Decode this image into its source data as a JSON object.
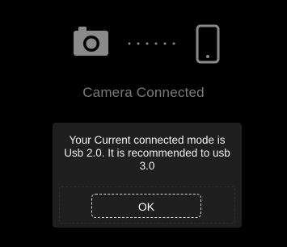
{
  "connection": {
    "left_icon": "camera-icon",
    "right_icon": "phone-icon",
    "link_icon": "dotted-link-icon",
    "icon_color": "#8a8a8a"
  },
  "status": {
    "label": "Camera Connected"
  },
  "dialog": {
    "message": "Your Current connected mode is Usb 2.0. It is recommended to usb 3.0",
    "ok_label": "OK"
  }
}
